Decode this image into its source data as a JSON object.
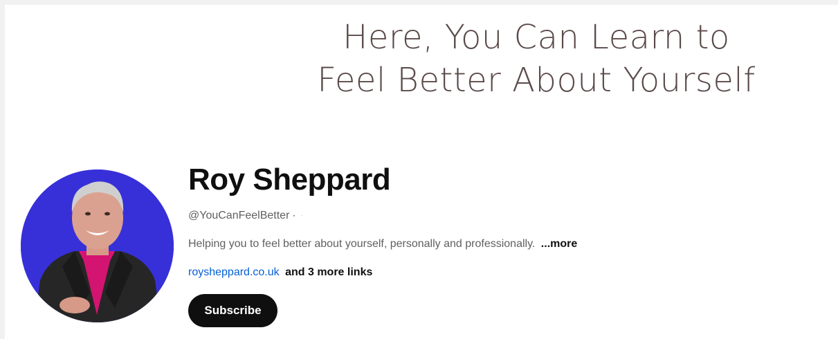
{
  "banner": {
    "line1": "Here, You Can Learn to",
    "line2": "Feel Better About Yourself",
    "text_color": "#5a4a49"
  },
  "channel": {
    "name": "Roy Sheppard",
    "handle": "@YouCanFeelBetter",
    "handle_separator": "·",
    "handle_trailing": "·",
    "description": "Helping you to feel better about yourself, personally and professionally.",
    "description_more": "...more",
    "primary_link": "roysheppard.co.uk",
    "more_links": "and 3 more links",
    "avatar_background": "#3730d9"
  },
  "actions": {
    "subscribe_label": "Subscribe"
  },
  "colors": {
    "link": "#065fd4",
    "button_bg": "#0f0f0f",
    "secondary_text": "#606060"
  }
}
